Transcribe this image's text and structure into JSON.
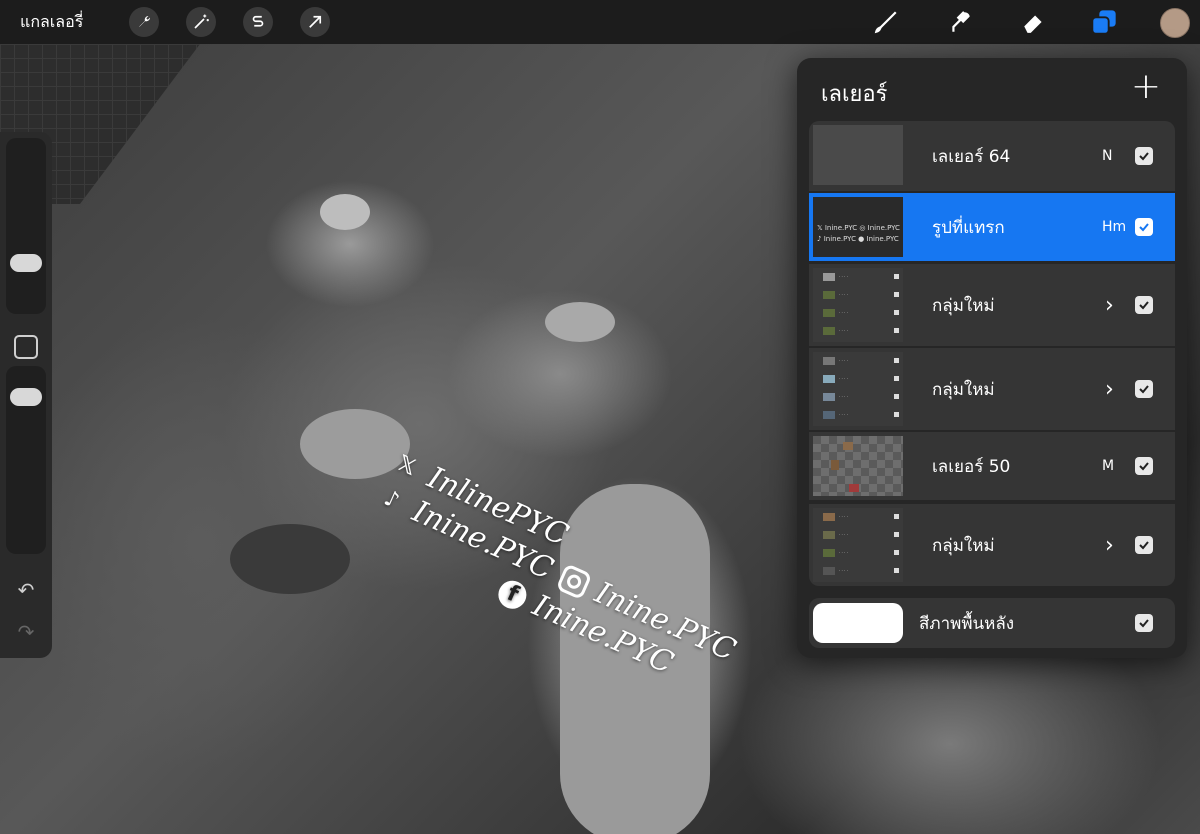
{
  "topbar": {
    "gallery_label": "แกลเลอรี่",
    "tools_left": [
      "wrench-icon",
      "magic-wand-icon",
      "selection-s-icon",
      "transform-arrow-icon"
    ],
    "tools_right": [
      "brush-icon",
      "smudge-icon",
      "eraser-icon",
      "layers-icon",
      "color-swatch"
    ],
    "active_tool_color": "#1a7cf5",
    "avatar_color": "#b49a86"
  },
  "sidebar": {
    "size_slider_level": 0.35,
    "opacity_slider_level": 0.85,
    "undo_icon": "undo-icon",
    "redo_icon": "redo-icon"
  },
  "watermark": {
    "x_handle": "InlinePYC",
    "tiktok_handle": "Inine.PYC",
    "instagram_handle": "Inine.PYC",
    "facebook_handle": "Inine.PYC"
  },
  "layers_panel": {
    "title": "เลเยอร์",
    "layers": [
      {
        "name": "เลเยอร์ 64",
        "blend": "N",
        "type": "layer",
        "visible": true,
        "selected": false
      },
      {
        "name": "รูปที่แทรก",
        "blend": "Hm",
        "type": "layer",
        "visible": true,
        "selected": true
      },
      {
        "name": "กลุ่มใหม่",
        "blend": "",
        "type": "group",
        "visible": true,
        "selected": false
      },
      {
        "name": "กลุ่มใหม่",
        "blend": "",
        "type": "group",
        "visible": true,
        "selected": false
      },
      {
        "name": "เลเยอร์ 50",
        "blend": "M",
        "type": "layer",
        "visible": true,
        "selected": false
      },
      {
        "name": "กลุ่มใหม่",
        "blend": "",
        "type": "group",
        "visible": true,
        "selected": false
      }
    ],
    "background": {
      "name": "สีภาพพื้นหลัง",
      "visible": true,
      "color": "#ffffff"
    },
    "selected_color": "#1677f2"
  }
}
